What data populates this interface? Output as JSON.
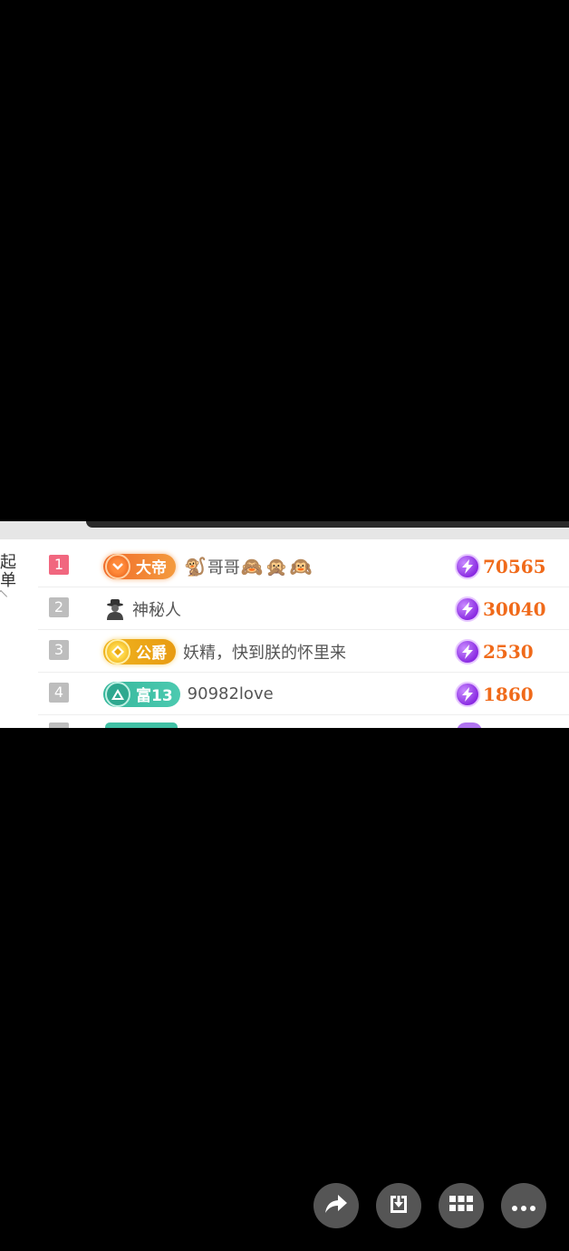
{
  "side_panel": {
    "label": "起\n单"
  },
  "leaderboard": [
    {
      "rank": "1",
      "badge": {
        "label": "大帝",
        "style": "emperor"
      },
      "name_parts": [
        "🐒",
        "哥哥",
        "🙈",
        "🙊",
        "🙉"
      ],
      "score": "70565"
    },
    {
      "rank": "2",
      "badge": null,
      "anonymous": true,
      "name": "神秘人",
      "score": "30040"
    },
    {
      "rank": "3",
      "badge": {
        "label": "公爵",
        "style": "duke"
      },
      "name": "妖精，快到朕的怀里来",
      "score": "2530"
    },
    {
      "rank": "4",
      "badge": {
        "label": "富13",
        "style": "rich"
      },
      "name": "90982love",
      "score": "1860"
    }
  ],
  "colors": {
    "score": "#f06a1a",
    "rank_first": "#f1677f",
    "rank_other": "#bdbdbd",
    "action_button": "#555555"
  },
  "actions": [
    {
      "icon": "share-arrow-icon"
    },
    {
      "icon": "download-icon"
    },
    {
      "icon": "grid-icon"
    },
    {
      "icon": "more-icon"
    }
  ]
}
